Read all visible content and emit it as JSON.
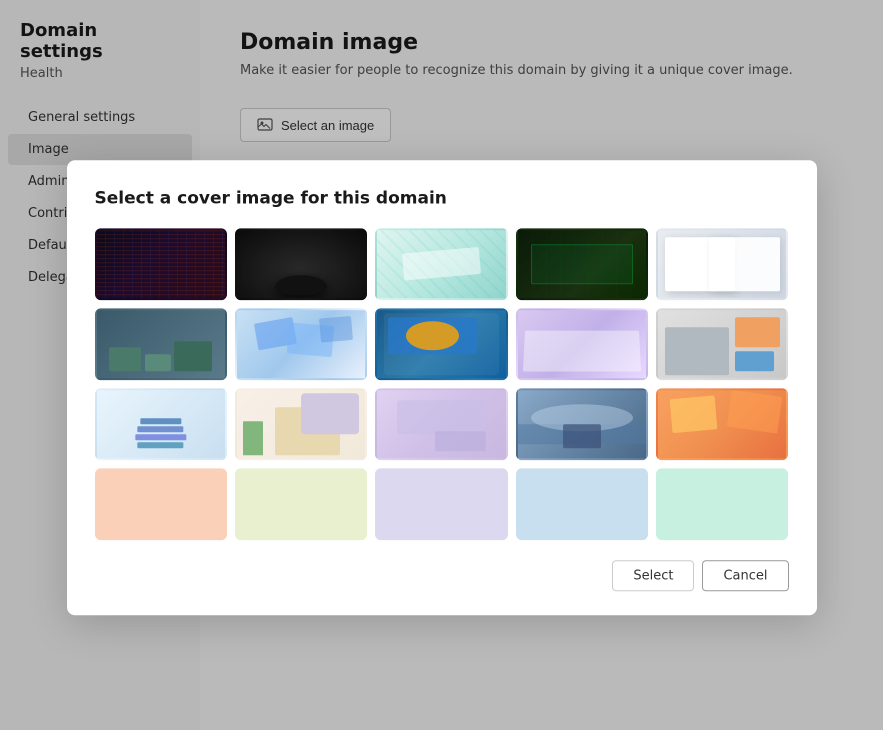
{
  "sidebar": {
    "title": "Domain settings",
    "subtitle": "Health",
    "items": [
      {
        "id": "general-settings",
        "label": "General settings",
        "active": false
      },
      {
        "id": "image",
        "label": "Image",
        "active": true
      },
      {
        "id": "admins",
        "label": "Admins",
        "active": false
      },
      {
        "id": "contributors",
        "label": "Contributors",
        "active": false
      },
      {
        "id": "default-domain",
        "label": "Default doma...",
        "active": false
      },
      {
        "id": "delegated-se",
        "label": "Delegated Se...",
        "active": false
      }
    ]
  },
  "main": {
    "title": "Domain image",
    "description": "Make it easier for people to recognize this domain by giving it a unique cover image.",
    "select_image_label": "Select an image"
  },
  "modal": {
    "title": "Select a cover image for this domain",
    "buttons": {
      "select": "Select",
      "cancel": "Cancel"
    },
    "images": [
      {
        "id": "img-1",
        "type": "image",
        "color": "#1a1a2e",
        "description": "code-dark"
      },
      {
        "id": "img-2",
        "type": "image",
        "color": "#1c1c1c",
        "description": "dark-mouse"
      },
      {
        "id": "img-3",
        "type": "image",
        "color": "#c8e8e0",
        "description": "circuit-teal"
      },
      {
        "id": "img-4",
        "type": "image",
        "color": "#1a2e1a",
        "description": "spreadsheet-green"
      },
      {
        "id": "img-5",
        "type": "image",
        "color": "#d0d8e0",
        "description": "notebook"
      },
      {
        "id": "img-6",
        "type": "image",
        "color": "#4a6878",
        "description": "3d-blocks-teal"
      },
      {
        "id": "img-7",
        "type": "image",
        "color": "#a8c8e8",
        "description": "3d-glass-blue"
      },
      {
        "id": "img-8",
        "type": "image",
        "color": "#2a6898",
        "description": "tablet-blue"
      },
      {
        "id": "img-9",
        "type": "image",
        "color": "#c8b8e8",
        "description": "papers-purple"
      },
      {
        "id": "img-10",
        "type": "image",
        "color": "#c8c8c8",
        "description": "office-3d"
      },
      {
        "id": "img-11",
        "type": "image",
        "color": "#d8e8f0",
        "description": "books-stack"
      },
      {
        "id": "img-12",
        "type": "image",
        "color": "#e8d8c0",
        "description": "desk-plant"
      },
      {
        "id": "img-13",
        "type": "image",
        "color": "#d0c8e0",
        "description": "laptop-purple"
      },
      {
        "id": "img-14",
        "type": "image",
        "color": "#6888a8",
        "description": "landscape-blue"
      },
      {
        "id": "img-15",
        "type": "image",
        "color": "#f0a878",
        "description": "orange-abstract"
      },
      {
        "id": "color-1",
        "type": "color",
        "color": "#fbd0b8",
        "description": "peach"
      },
      {
        "id": "color-2",
        "type": "color",
        "color": "#e8f0d0",
        "description": "light-green"
      },
      {
        "id": "color-3",
        "type": "color",
        "color": "#dcd8f0",
        "description": "light-lavender"
      },
      {
        "id": "color-4",
        "type": "color",
        "color": "#c8dff0",
        "description": "light-blue"
      },
      {
        "id": "color-5",
        "type": "color",
        "color": "#c8f0e0",
        "description": "light-mint"
      }
    ]
  }
}
